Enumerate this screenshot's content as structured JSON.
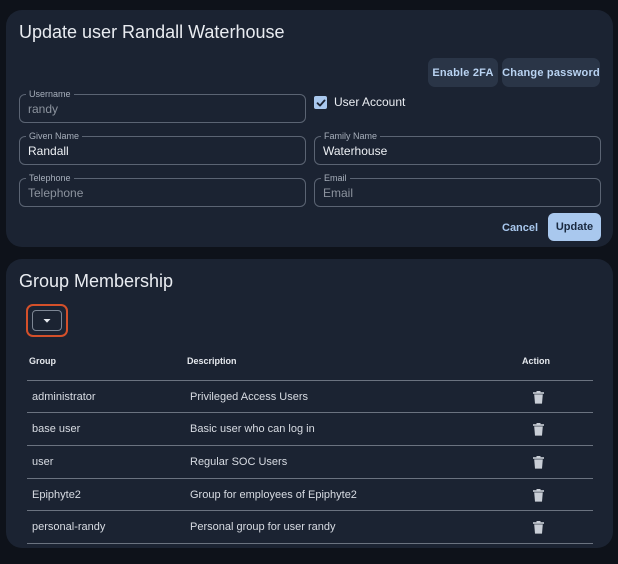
{
  "user_card": {
    "title": "Update user Randall Waterhouse",
    "enable_2fa_label": "Enable 2FA",
    "change_password_label": "Change password",
    "username": {
      "label": "Username",
      "value": "randy"
    },
    "user_account": {
      "label": "User Account",
      "checked": true
    },
    "given_name": {
      "label": "Given Name",
      "value": "Randall"
    },
    "family_name": {
      "label": "Family Name",
      "value": "Waterhouse"
    },
    "telephone": {
      "label": "Telephone",
      "placeholder": "Telephone"
    },
    "email": {
      "label": "Email",
      "placeholder": "Email"
    },
    "cancel_label": "Cancel",
    "update_label": "Update"
  },
  "group_card": {
    "title": "Group Membership",
    "columns": {
      "group": "Group",
      "description": "Description",
      "action": "Action"
    },
    "rows": [
      {
        "group": "administrator",
        "description": "Privileged Access Users"
      },
      {
        "group": "base user",
        "description": "Basic user who can log in"
      },
      {
        "group": "user",
        "description": "Regular SOC Users"
      },
      {
        "group": "Epiphyte2",
        "description": "Group for employees of Epiphyte2"
      },
      {
        "group": "personal-randy",
        "description": "Personal group for user randy"
      }
    ]
  },
  "icons": {
    "checkbox": "check-icon",
    "dropdown": "caret-down-icon",
    "delete": "trash-icon"
  },
  "colors": {
    "background": "#0e121a",
    "card": "#1b2332",
    "accent": "#a9c8ee",
    "focus_outline": "#d4502a"
  }
}
